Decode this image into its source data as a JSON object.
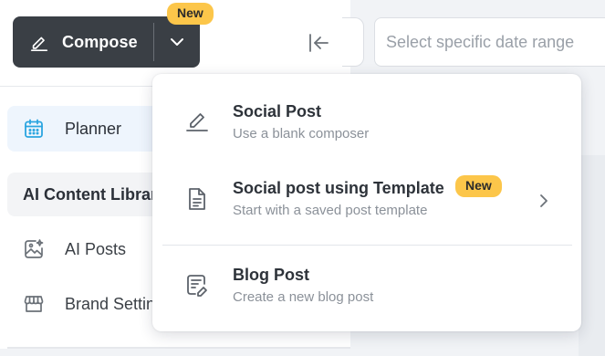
{
  "compose": {
    "label": "Compose",
    "badge": "New"
  },
  "date_filter": {
    "placeholder": "Select specific date range"
  },
  "sidebar": {
    "planner": "Planner",
    "section_header": "AI Content Library",
    "items": [
      {
        "label": "AI Posts",
        "icon": "image-sparkle-icon"
      },
      {
        "label": "Brand Settings",
        "icon": "store-icon"
      }
    ]
  },
  "dropdown": {
    "items": [
      {
        "title": "Social Post",
        "subtitle": "Use a blank composer",
        "icon": "pencil-icon"
      },
      {
        "title": "Social post using Template",
        "subtitle": "Start with a saved post template",
        "icon": "document-icon",
        "badge": "New"
      },
      {
        "title": "Blog Post",
        "subtitle": "Create a new blog post",
        "icon": "blog-icon"
      }
    ]
  },
  "colors": {
    "compose_bg": "#3a3f45",
    "badge_bg": "#fcc64a",
    "planner_icon": "#2aa5e0",
    "planner_bg": "#eef5fd"
  }
}
